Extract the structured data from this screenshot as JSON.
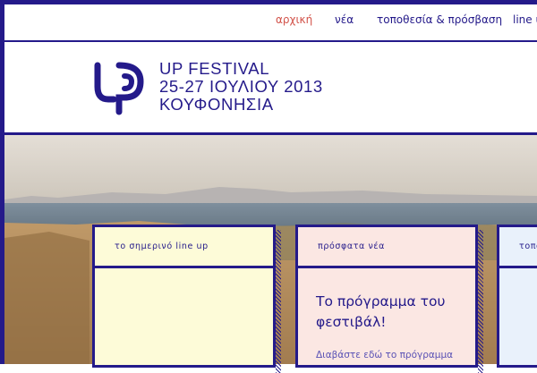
{
  "nav": {
    "items": [
      {
        "label": "αρχική",
        "active": true
      },
      {
        "label": "νέα"
      },
      {
        "label": "τοποθεσία & πρόσβαση"
      },
      {
        "label": "line u"
      }
    ]
  },
  "header": {
    "logo_icon": "up-festival-logo",
    "line1": "UP FESTIVAL",
    "line2": "25-27 ΙΟΥΛΙΟΥ 2013",
    "line3": "ΚΟΥΦΟΝΗΣΙΑ"
  },
  "cards": {
    "lineup": {
      "heading": "το σημερινό line up"
    },
    "news": {
      "heading": "πρόσφατα νέα",
      "title_line1": "Το πρόγραμμα του",
      "title_line2": "φεστιβάλ!",
      "teaser": "Διαβάστε εδώ το πρόγραμμα"
    },
    "third": {
      "heading": "τοπο"
    }
  },
  "colors": {
    "brand": "#241a8a",
    "active_nav": "#d2534a",
    "card_lineup_bg": "#fdfbd8",
    "card_news_bg": "#fbe7e3",
    "card_third_bg": "#e9f1fb"
  }
}
